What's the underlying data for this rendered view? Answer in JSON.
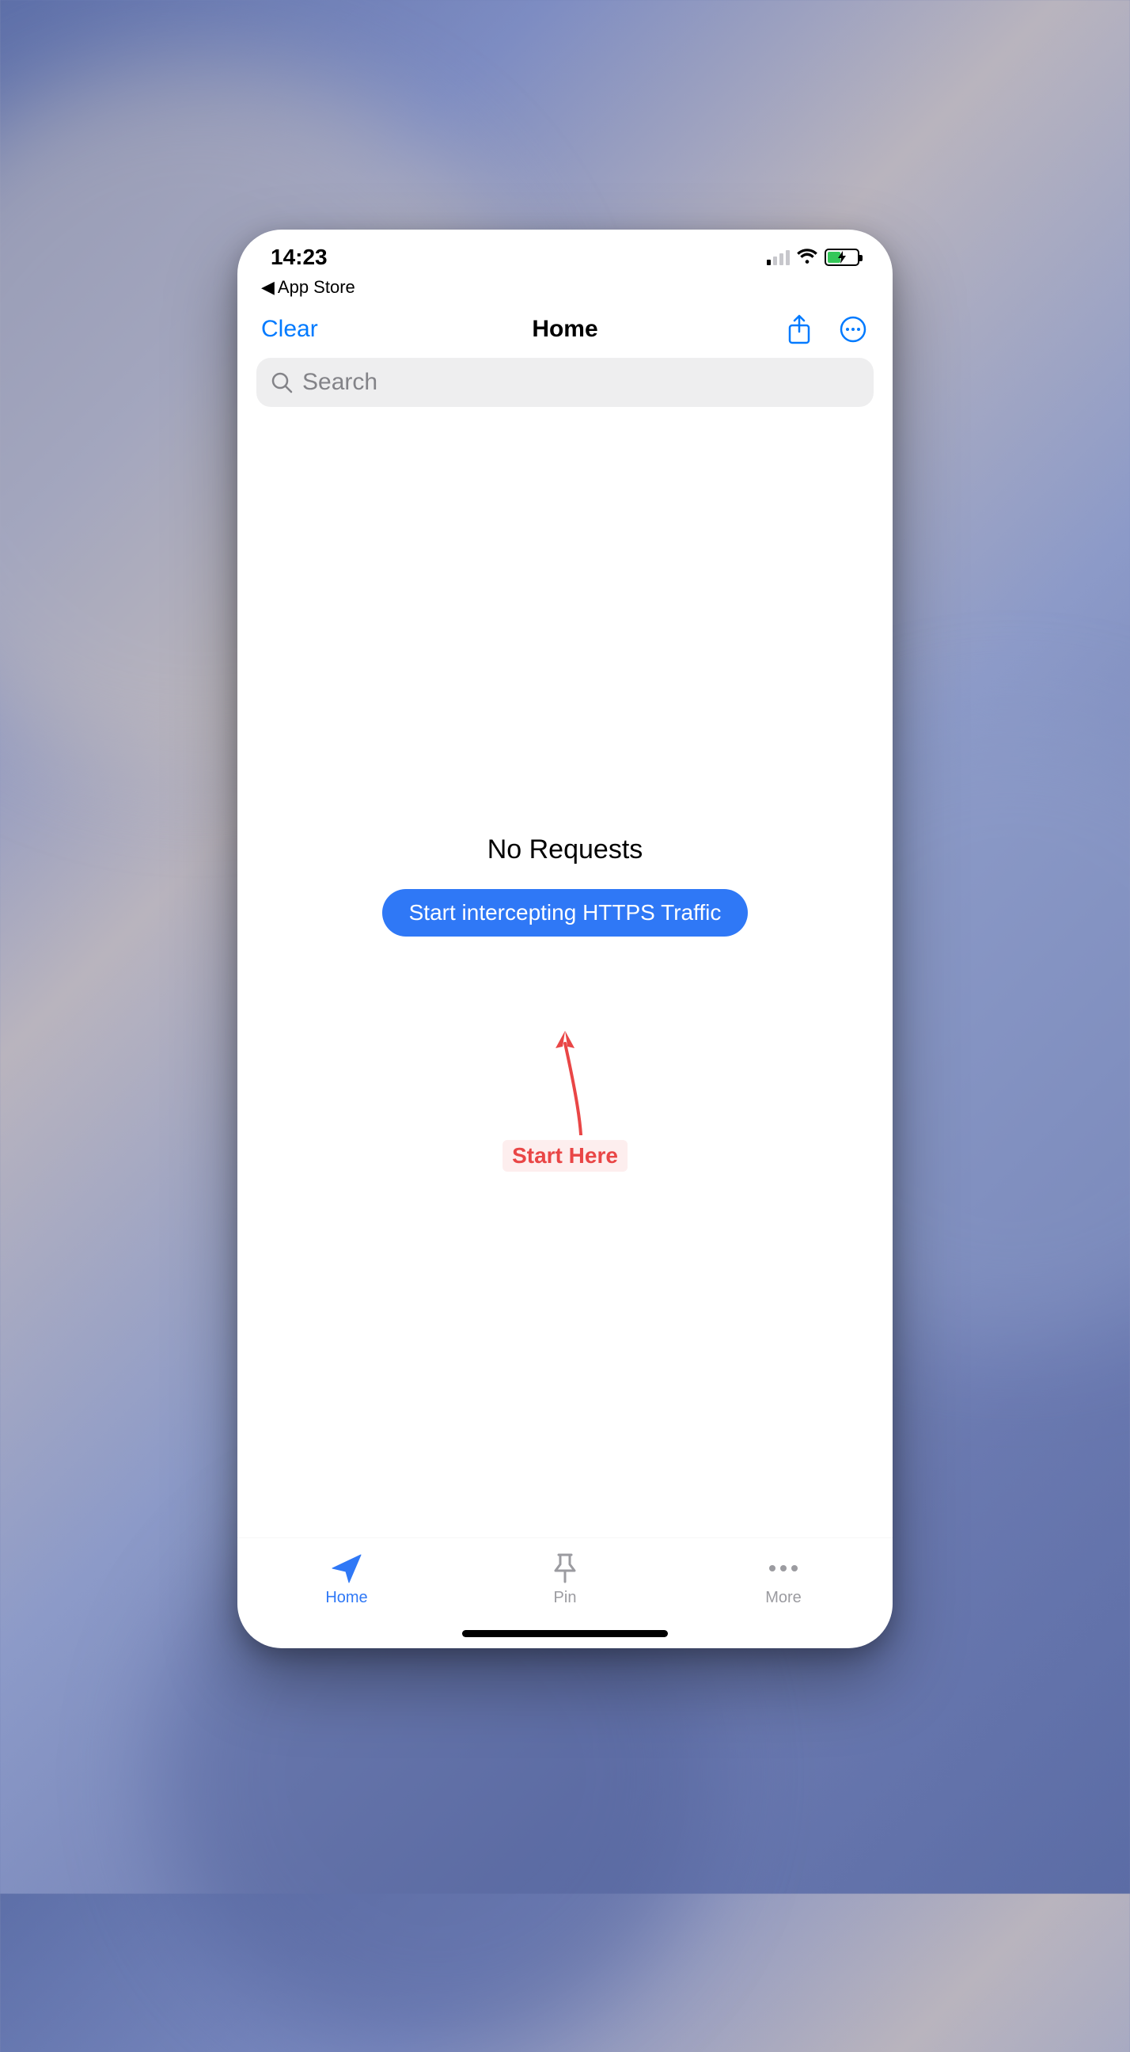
{
  "status": {
    "time": "14:23",
    "breadcrumb_prefix": "◀",
    "breadcrumb_label": "App Store"
  },
  "nav": {
    "clear_label": "Clear",
    "title": "Home"
  },
  "search": {
    "placeholder": "Search",
    "value": ""
  },
  "empty": {
    "title": "No Requests",
    "button_label": "Start intercepting HTTPS Traffic"
  },
  "annotation": {
    "label": "Start Here"
  },
  "tabs": {
    "home": "Home",
    "pin": "Pin",
    "more": "More"
  },
  "colors": {
    "accent": "#007aff",
    "primary_button": "#2f78f6",
    "annotation_red": "#e94646",
    "battery_green": "#34c759"
  }
}
